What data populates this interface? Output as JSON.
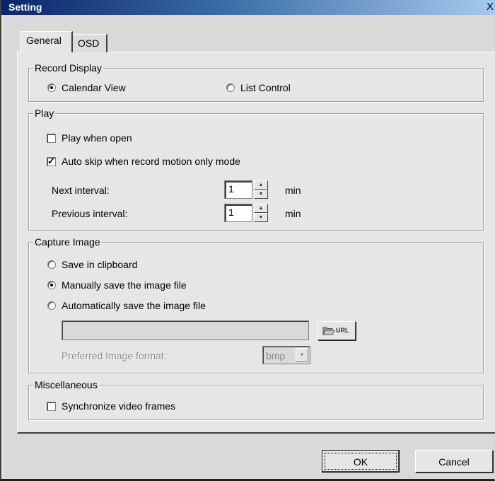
{
  "window": {
    "title": "Setting",
    "close_glyph": "X"
  },
  "tabs": [
    {
      "label": "General",
      "active": true
    },
    {
      "label": "OSD",
      "active": false
    }
  ],
  "record_display": {
    "legend": "Record Display",
    "options": [
      {
        "label": "Calendar View",
        "selected": true
      },
      {
        "label": "List Control",
        "selected": false
      }
    ]
  },
  "play": {
    "legend": "Play",
    "play_when_open": {
      "label": "Play when open",
      "checked": false
    },
    "auto_skip": {
      "label": "Auto skip when record motion only mode",
      "checked": true
    },
    "next_interval": {
      "label": "Next interval:",
      "value": "1",
      "unit": "min"
    },
    "previous_interval": {
      "label": "Previous interval:",
      "value": "1",
      "unit": "min"
    }
  },
  "capture_image": {
    "legend": "Capture Image",
    "options": [
      {
        "label": "Save in clipboard",
        "selected": false
      },
      {
        "label": "Manually save the image file",
        "selected": true
      },
      {
        "label": "Automatically save the image file",
        "selected": false
      }
    ],
    "path_value": "",
    "browse_button_label": "URL",
    "format_label": "Preferred Image format:",
    "format_value": "bmp"
  },
  "miscellaneous": {
    "legend": "Miscellaneous",
    "sync": {
      "label": "Synchronize video frames",
      "checked": false
    }
  },
  "buttons": {
    "ok": "OK",
    "cancel": "Cancel"
  },
  "icons": {
    "folder": "folder-icon",
    "spin_up": "up-arrow-icon",
    "spin_down": "down-arrow-icon",
    "dropdown": "chevron-down-icon"
  }
}
